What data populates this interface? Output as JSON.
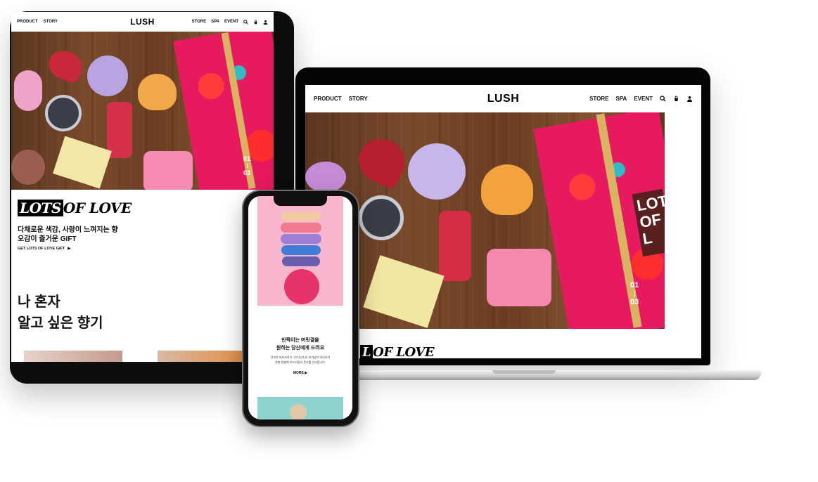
{
  "nav": {
    "logo": "LUSH",
    "left_items": [
      "PRODUCT",
      "STORY"
    ],
    "right_items": [
      "STORE",
      "SPA",
      "EVENT"
    ],
    "icons": [
      "search-icon",
      "cart-icon",
      "user-icon"
    ]
  },
  "hero": {
    "slide_current": "01",
    "slide_total": "03",
    "box_text": "LOTS OF L"
  },
  "tablet": {
    "campaign_logo_dark": "LOTS",
    "campaign_logo_light": "OF LOVE",
    "headline_line1": "다채로운 색감, 사랑이 느껴지는 향",
    "headline_line2": "오감이 즐거운 GIFT",
    "cta": "GET LOTS OF LOVE GIFT",
    "section_title_line1": "나 혼자",
    "section_title_line2": "알고 싶은 향기"
  },
  "laptop": {
    "campaign_logo_dark": "L",
    "campaign_logo_light": "OF LOVE"
  },
  "phone": {
    "headline_line1": "반짝이는 머릿결을",
    "headline_line2": "원하는 당신에게 드려요",
    "body_line1": "건조한 머리카락이 그리고(가)로 효과넘치 머리카락",
    "body_line2": "한층 한층에 부드러움과 윤기를 선사합니다.",
    "more": "MORE"
  },
  "colors": {
    "accent_pink": "#e7195f",
    "ribbon_gold": "#d8b462",
    "brand_black": "#000000"
  }
}
